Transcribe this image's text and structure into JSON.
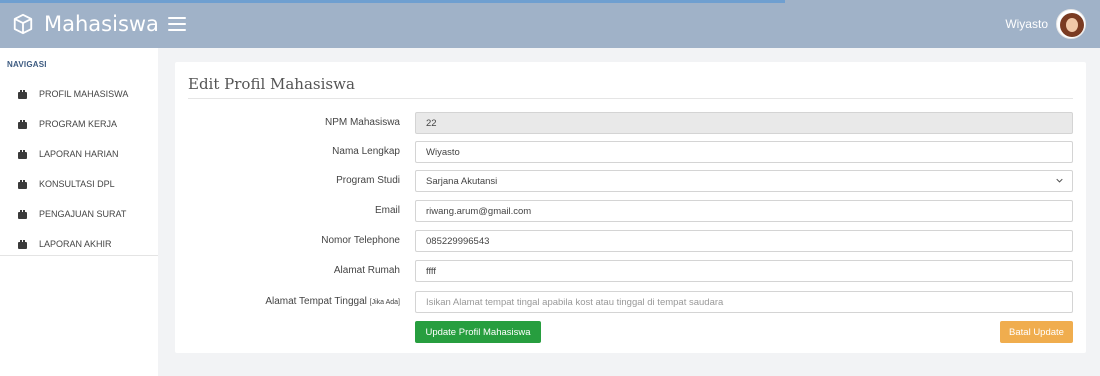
{
  "header": {
    "app_title": "Mahasiswa",
    "user_name": "Wiyasto"
  },
  "sidebar": {
    "heading": "NAVIGASI",
    "items": [
      {
        "label": "PROFIL MAHASISWA"
      },
      {
        "label": "PROGRAM KERJA"
      },
      {
        "label": "LAPORAN HARIAN"
      },
      {
        "label": "KONSULTASI DPL"
      },
      {
        "label": "PENGAJUAN SURAT"
      },
      {
        "label": "LAPORAN AKHIR"
      }
    ]
  },
  "form": {
    "title": "Edit Profil Mahasiswa",
    "fields": {
      "npm": {
        "label": "NPM Mahasiswa",
        "value": "22"
      },
      "nama": {
        "label": "Nama Lengkap",
        "value": "Wiyasto"
      },
      "prodi": {
        "label": "Program Studi",
        "value": "Sarjana Akutansi"
      },
      "email": {
        "label": "Email",
        "value": "riwang.arum@gmail.com"
      },
      "telp": {
        "label": "Nomor Telephone",
        "value": "085229996543"
      },
      "alamat": {
        "label": "Alamat Rumah",
        "value": "ffff"
      },
      "tinggal": {
        "label": "Alamat Tempat Tinggal",
        "label_suffix": "[Jika Ada]",
        "value": "",
        "placeholder": "Isikan Alamat tempat tingal apabila kost atau tinggal di tempat saudara"
      }
    },
    "buttons": {
      "update": "Update Profil Mahasiswa",
      "cancel": "Batal Update"
    }
  },
  "colors": {
    "topbar": "#a0b2c8",
    "update_button": "#279e3f",
    "cancel_button": "#f0ad4e"
  }
}
